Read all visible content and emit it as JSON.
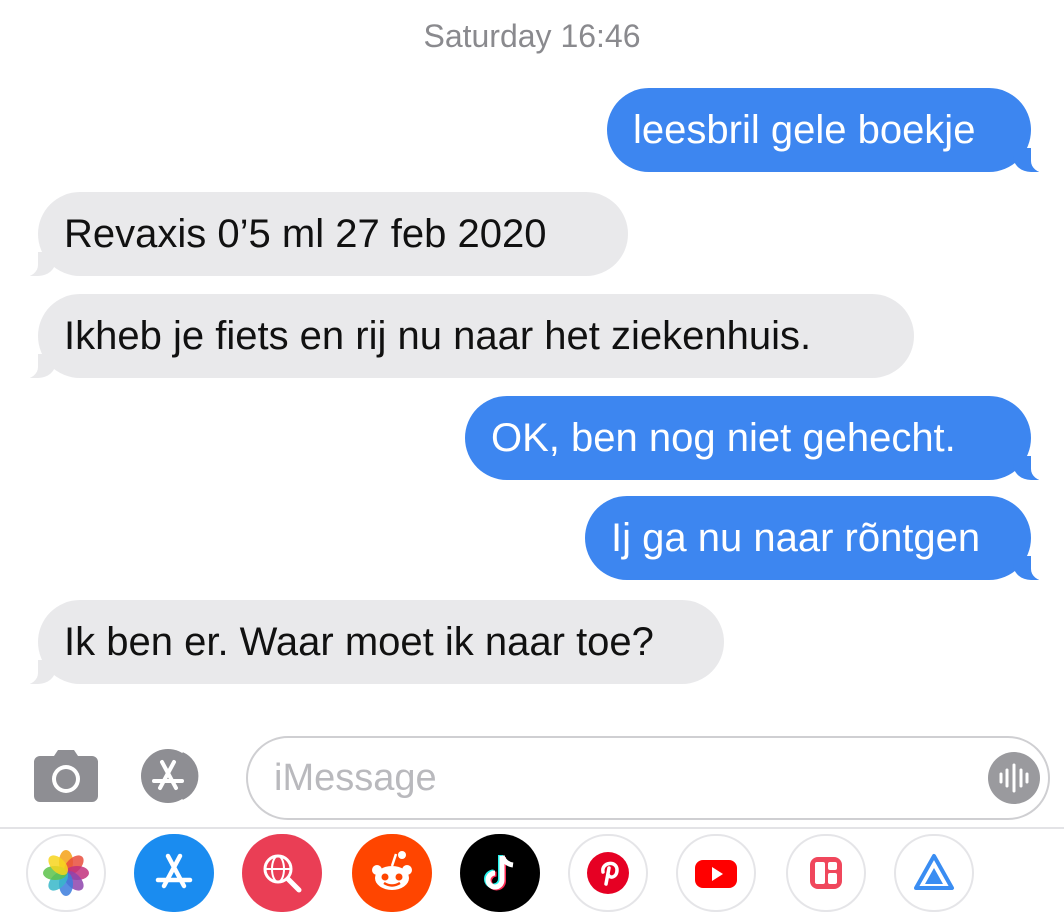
{
  "conversation": {
    "timestamp": "Saturday 16:46",
    "messages": [
      {
        "direction": "outgoing",
        "text": "leesbril gele boekje"
      },
      {
        "direction": "incoming",
        "text": "Revaxis 0’5 ml 27 feb 2020"
      },
      {
        "direction": "incoming",
        "text": "Ikheb je fiets en rij nu naar het ziekenhuis."
      },
      {
        "direction": "outgoing",
        "text": "OK, ben nog niet gehecht."
      },
      {
        "direction": "outgoing",
        "text": "Ij ga nu naar rõntgen"
      },
      {
        "direction": "incoming",
        "text": "Ik ben er. Waar moet ik naar toe?"
      }
    ]
  },
  "input_bar": {
    "placeholder": "iMessage",
    "icons": [
      "camera-icon",
      "app-store-icon",
      "dictation-icon"
    ]
  },
  "app_drawer": {
    "apps": [
      "photos-icon",
      "app-store-icon",
      "search-globe-icon",
      "reddit-icon",
      "tiktok-icon",
      "pinterest-icon",
      "youtube-icon",
      "collage-icon",
      "triangle-app-icon"
    ]
  },
  "colors": {
    "outgoing_bubble": "#3d86f0",
    "incoming_bubble": "#e9e9eb",
    "timestamp": "#8a8a8e"
  }
}
